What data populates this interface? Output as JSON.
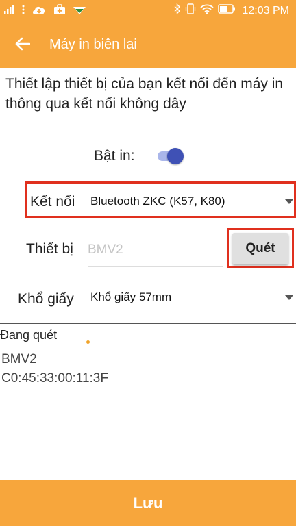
{
  "status_bar": {
    "time": "12:03",
    "time_suffix": "PM",
    "icons": [
      "signal-icon",
      "overflow-dots-icon",
      "cloud-download-icon",
      "medical-bag-icon",
      "app-notification-icon",
      "bluetooth-icon",
      "vibrate-icon",
      "wifi-icon",
      "battery-icon"
    ],
    "color": "#f7a63c"
  },
  "header": {
    "title": "Máy in biên lai",
    "back_icon": "arrow-left-icon"
  },
  "description": "Thiết lập thiết bị của bạn kết nối đến máy in thông qua kết nối không dây",
  "print_toggle": {
    "label": "Bật in:",
    "enabled": true,
    "color": "#3f51b5"
  },
  "connection": {
    "label": "Kết nối",
    "selected": "Bluetooth ZKC (K57, K80)"
  },
  "device": {
    "label": "Thiết bị",
    "placeholder": "BMV2",
    "scan_label": "Quét"
  },
  "paper_size": {
    "label": "Khổ giấy",
    "selected": "Khổ giấy 57mm"
  },
  "scan_results": {
    "status": "Đang quét",
    "devices": [
      {
        "name": "BMV2",
        "mac": "C0:45:33:00:11:3F"
      }
    ]
  },
  "footer": {
    "save_label": "Lưu"
  },
  "colors": {
    "accent": "#f7a63c",
    "highlight": "#e0301e"
  }
}
